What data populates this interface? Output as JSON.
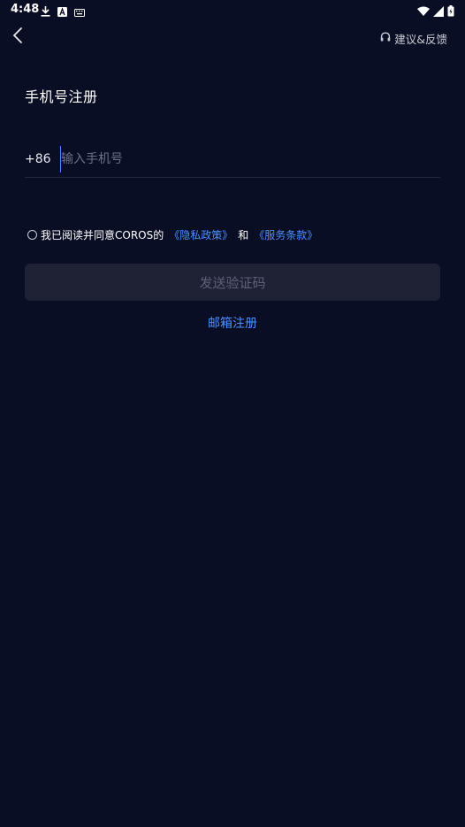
{
  "status_bar": {
    "time": "4:48"
  },
  "header": {
    "feedback_label": "建议&反馈"
  },
  "page": {
    "title": "手机号注册"
  },
  "phone": {
    "country_code": "+86",
    "placeholder": "输入手机号",
    "value": ""
  },
  "agreement": {
    "prefix": "我已阅读并同意COROS的",
    "privacy_link": "《隐私政策》",
    "and": "和",
    "terms_link": "《服务条款》",
    "checked": false
  },
  "actions": {
    "send_code_label": "发送验证码",
    "email_register_label": "邮箱注册"
  },
  "colors": {
    "background": "#0a0e24",
    "link": "#4a90ff",
    "button_disabled_bg": "#1f2235",
    "button_disabled_text": "#5d6178"
  }
}
